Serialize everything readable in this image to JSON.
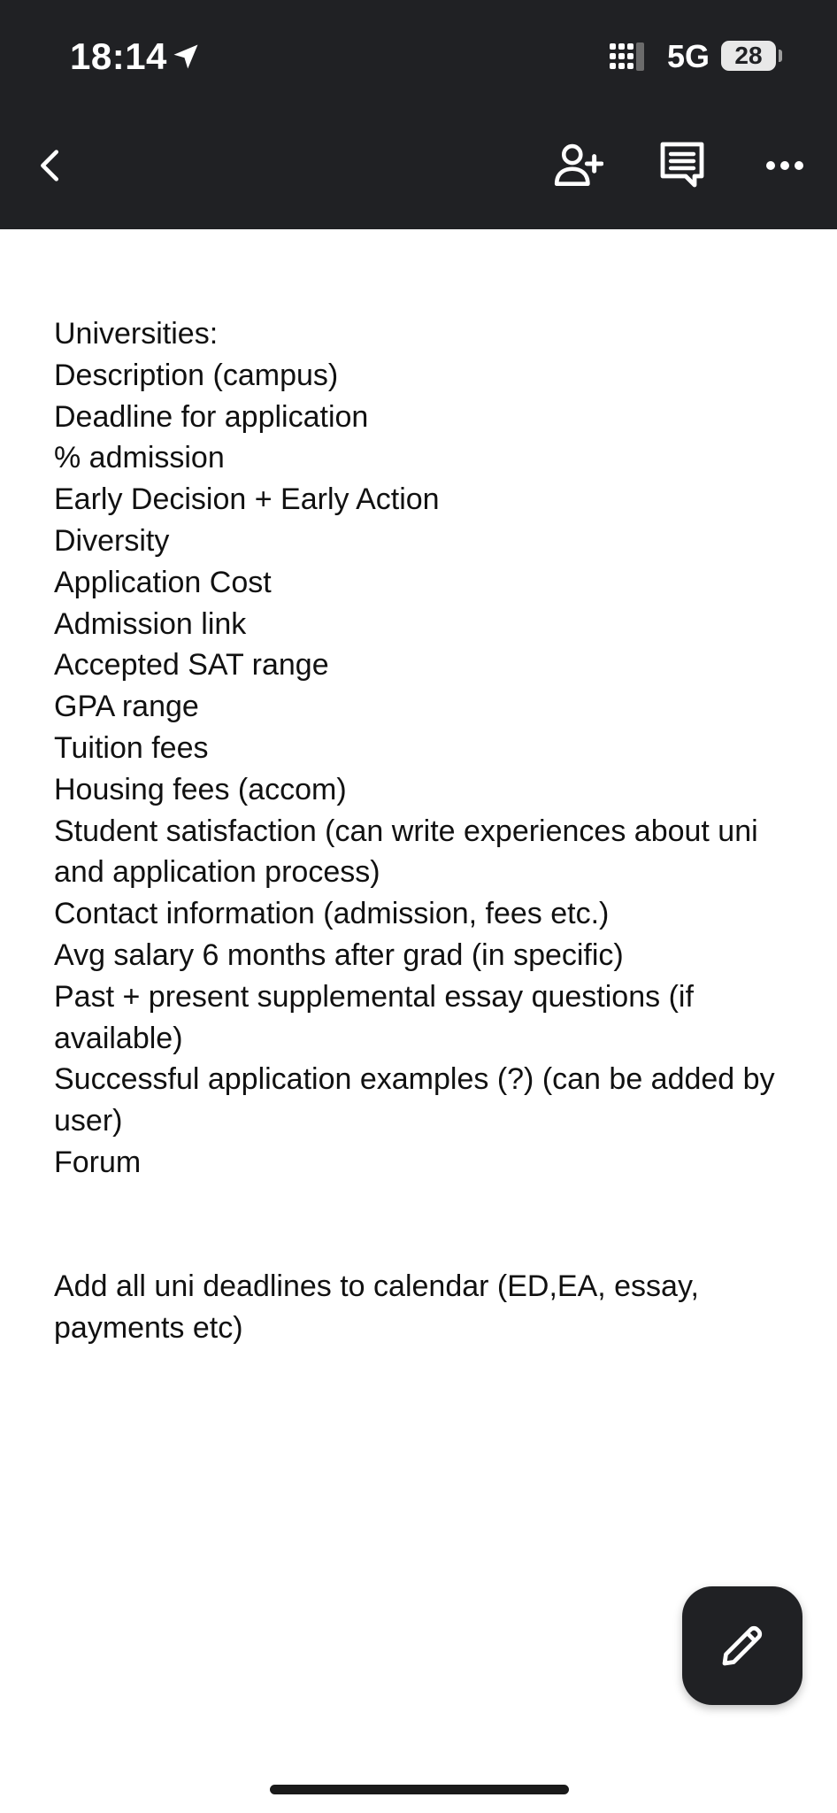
{
  "status_bar": {
    "time": "18:14",
    "network": "5G",
    "battery": "28"
  },
  "toolbar": {
    "back_icon": "chevron-left-icon",
    "share_icon": "person-add-icon",
    "comment_icon": "comment-icon",
    "more_icon": "more-horizontal-icon"
  },
  "document": {
    "lines": [
      "Universities:",
      "Description (campus)",
      "Deadline for application",
      "% admission",
      "Early Decision + Early Action",
      "Diversity",
      "Application Cost",
      "Admission link",
      "Accepted SAT range",
      "GPA range",
      "Tuition fees",
      "Housing fees (accom)",
      "Student satisfaction (can write experiences about uni and application process)",
      "Contact information (admission, fees etc.)",
      "Avg salary 6 months after grad (in specific)",
      "Past + present supplemental essay questions (if available)",
      "Successful application examples (?) (can be added by user)",
      "Forum"
    ],
    "footer_note": "Add all uni deadlines to calendar (ED,EA, essay, payments etc)"
  },
  "fab": {
    "icon": "pencil-icon"
  },
  "colors": {
    "toolbar_bg": "#202124",
    "text": "#111111",
    "background": "#ffffff"
  }
}
